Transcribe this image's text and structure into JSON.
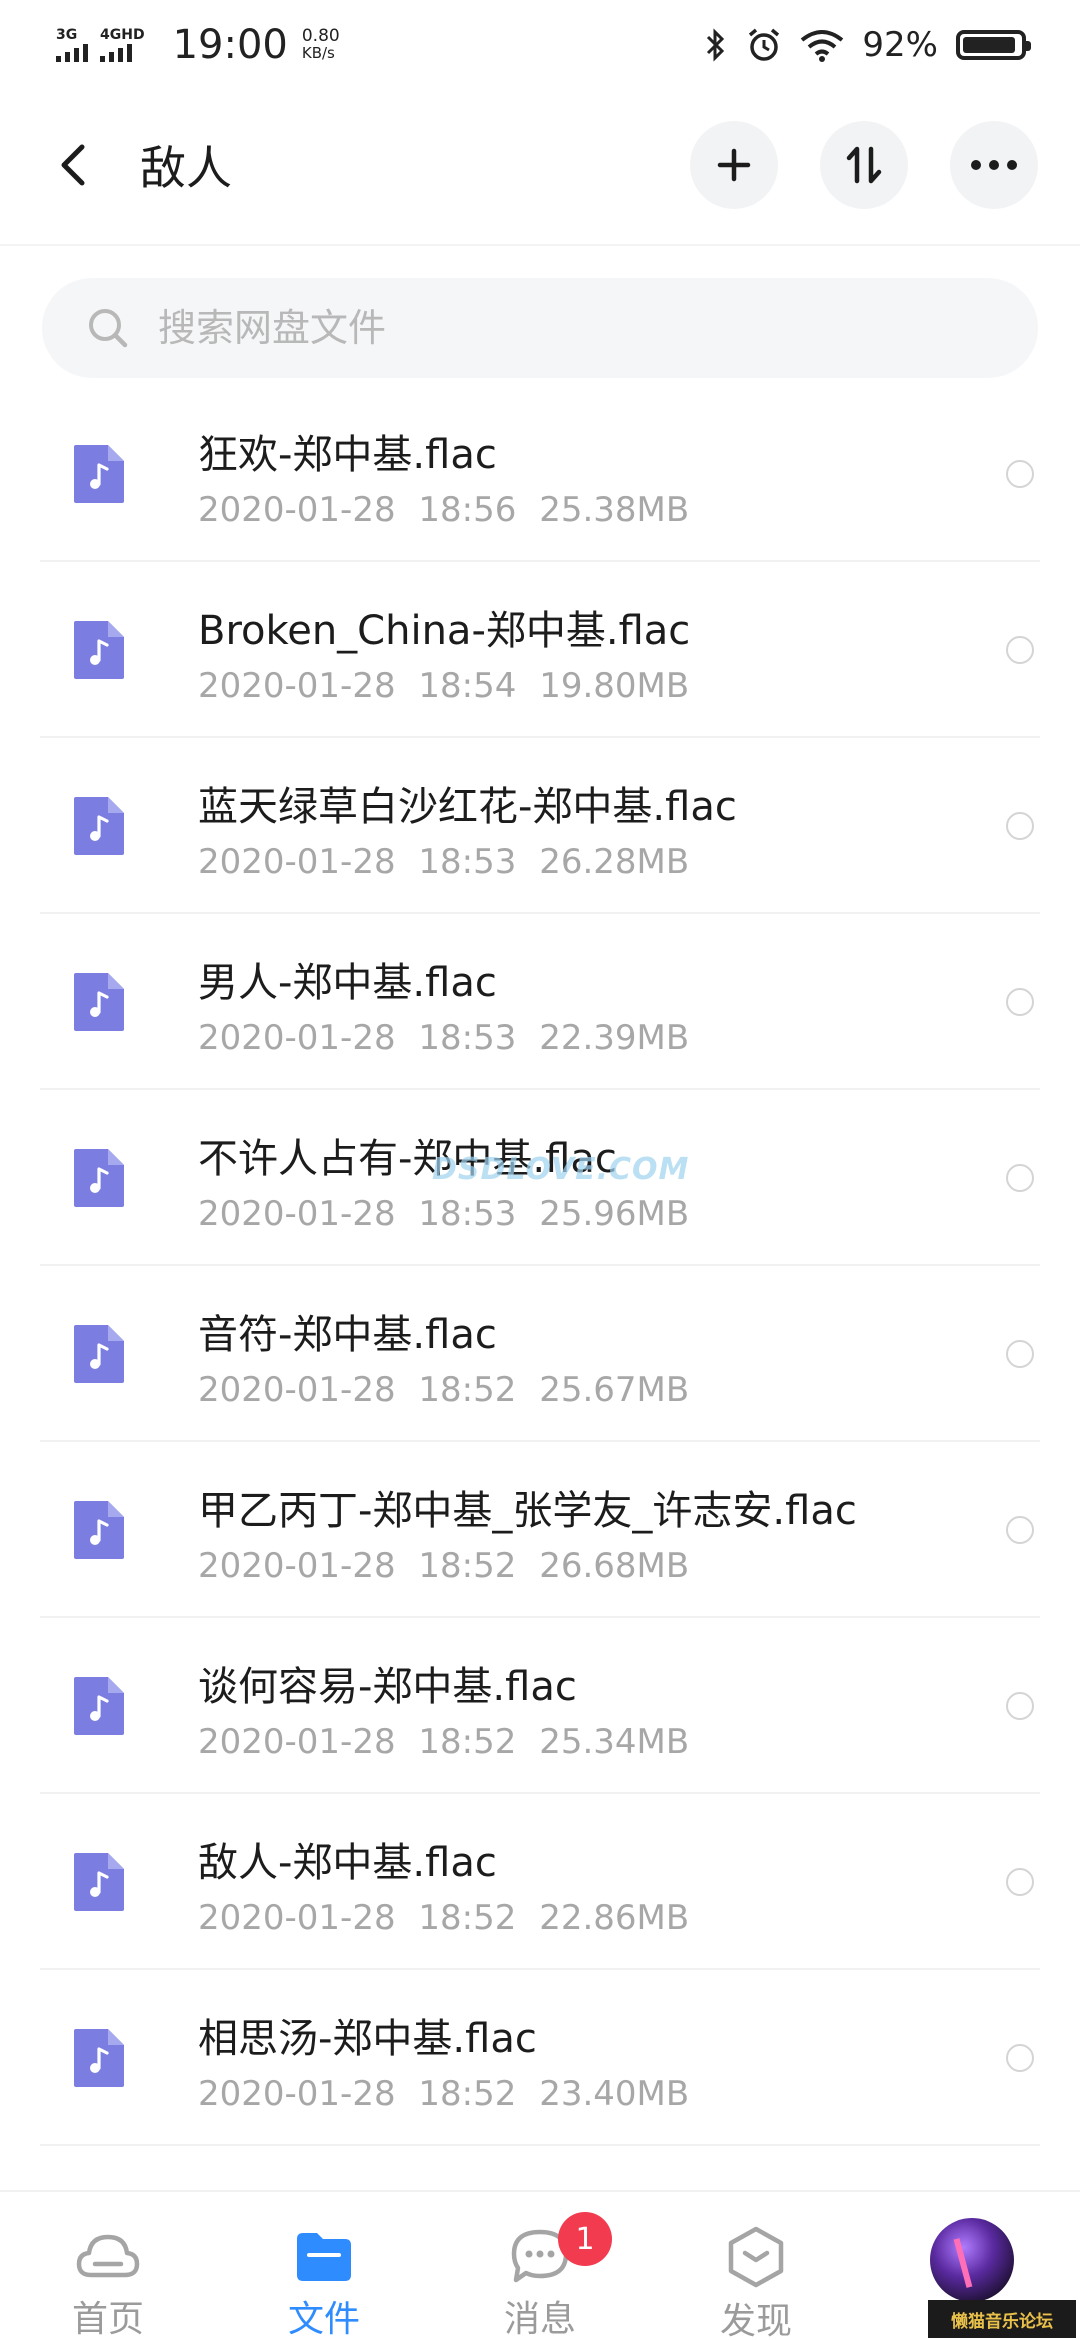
{
  "status_bar": {
    "network1": "3G",
    "network2": "4GHD",
    "time": "19:00",
    "speed_value": "0.80",
    "speed_unit": "KB/s",
    "battery_percent": "92%",
    "icons": [
      "bluetooth-icon",
      "alarm-icon",
      "wifi-icon",
      "battery-icon"
    ]
  },
  "header": {
    "title": "敌人",
    "actions": [
      "add-icon",
      "sort-icon",
      "more-icon"
    ]
  },
  "search": {
    "placeholder": "搜索网盘文件"
  },
  "files": [
    {
      "name": "狂欢-郑中基.flac",
      "date": "2020-01-28",
      "time": "18:56",
      "size": "25.38MB"
    },
    {
      "name": "Broken_China-郑中基.flac",
      "date": "2020-01-28",
      "time": "18:54",
      "size": "19.80MB"
    },
    {
      "name": "蓝天绿草白沙红花-郑中基.flac",
      "date": "2020-01-28",
      "time": "18:53",
      "size": "26.28MB"
    },
    {
      "name": "男人-郑中基.flac",
      "date": "2020-01-28",
      "time": "18:53",
      "size": "22.39MB"
    },
    {
      "name": "不许人占有-郑中基.flac",
      "date": "2020-01-28",
      "time": "18:53",
      "size": "25.96MB"
    },
    {
      "name": "音符-郑中基.flac",
      "date": "2020-01-28",
      "time": "18:52",
      "size": "25.67MB"
    },
    {
      "name": "甲乙丙丁-郑中基_张学友_许志安.flac",
      "date": "2020-01-28",
      "time": "18:52",
      "size": "26.68MB"
    },
    {
      "name": "谈何容易-郑中基.flac",
      "date": "2020-01-28",
      "time": "18:52",
      "size": "25.34MB"
    },
    {
      "name": "敌人-郑中基.flac",
      "date": "2020-01-28",
      "time": "18:52",
      "size": "22.86MB"
    },
    {
      "name": "相思汤-郑中基.flac",
      "date": "2020-01-28",
      "time": "18:52",
      "size": "23.40MB"
    }
  ],
  "watermark": "DSDLOVE.COM",
  "bottom_nav": {
    "items": [
      {
        "label": "首页",
        "icon": "cloud-icon"
      },
      {
        "label": "文件",
        "icon": "folder-icon",
        "active": true
      },
      {
        "label": "消息",
        "icon": "chat-icon",
        "badge": "1"
      },
      {
        "label": "发现",
        "icon": "discover-icon"
      },
      {
        "label": "",
        "icon": "avatar"
      }
    ]
  },
  "forum_logo": "懒猫音乐论坛",
  "colors": {
    "accent": "#2f8cff",
    "file_icon": "#7b7ee0",
    "badge": "#f33b4f"
  }
}
